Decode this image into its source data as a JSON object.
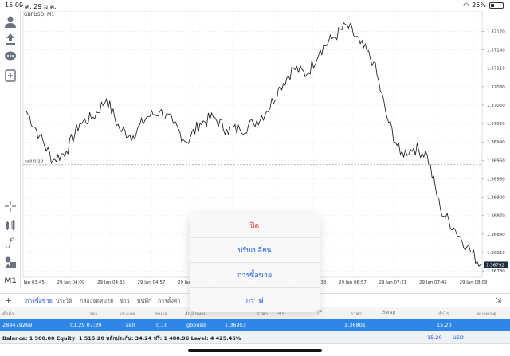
{
  "status": {
    "time": "15:09",
    "date": "ศ. 29 ม.ค.",
    "battery": "25%"
  },
  "chart": {
    "symbol_label": "GBPUSD, M1",
    "sell_label": "sell 0.10",
    "current_price_label": "1.36792",
    "price_ticks": [
      "1.37170",
      "1.37140",
      "1.37110",
      "1.37080",
      "1.37050",
      "1.37020",
      "1.36990",
      "1.36960",
      "1.36930",
      "1.36900",
      "1.36870",
      "1.36840",
      "1.36810",
      "1.36780"
    ],
    "time_ticks": [
      "29 Jan 03:45",
      "29 Jan 04:09",
      "29 Jan 04:33",
      "29 Jan 04:57",
      "29 Jan 05:21",
      "29 Jan 05:45",
      "29 Jan 06:09",
      "29 Jan 06:33",
      "29 Jan 06:57",
      "29 Jan 07:21",
      "29 Jan 07:45",
      "29 Jan 08:09"
    ]
  },
  "chart_data": {
    "type": "line",
    "title": "GBPUSD, M1",
    "xlabel": "",
    "ylabel": "",
    "ylim": [
      1.36775,
      1.3719
    ],
    "x": [
      "03:45",
      "03:52",
      "04:00",
      "04:09",
      "04:17",
      "04:25",
      "04:33",
      "04:41",
      "04:49",
      "04:57",
      "05:05",
      "05:13",
      "05:21",
      "05:29",
      "05:37",
      "05:45",
      "05:53",
      "06:01",
      "06:09",
      "06:17",
      "06:25",
      "06:33",
      "06:41",
      "06:49",
      "06:57",
      "07:05",
      "07:13",
      "07:21",
      "07:29",
      "07:37",
      "07:45",
      "07:53",
      "08:01",
      "08:05",
      "08:08"
    ],
    "y": [
      1.3704,
      1.37,
      1.3696,
      1.36975,
      1.3702,
      1.3703,
      1.3706,
      1.3701,
      1.37,
      1.3703,
      1.3704,
      1.3702,
      1.3699,
      1.3702,
      1.3703,
      1.3701,
      1.3701,
      1.3702,
      1.3704,
      1.3708,
      1.3711,
      1.371,
      1.3714,
      1.3716,
      1.3718,
      1.3715,
      1.3712,
      1.3703,
      1.3697,
      1.3698,
      1.3697,
      1.3688,
      1.3685,
      1.3682,
      1.3679
    ],
    "horizontal_line": {
      "label": "sell 0.10",
      "value": 1.36953
    }
  },
  "tabs": [
    "การซื้อขาย",
    "ประวัติ",
    "กล่องจดหมาย",
    "ข่าว",
    "บันทึก",
    "การตั้งค่า"
  ],
  "columns": [
    "คำสั่ง",
    "เวลา",
    "ประเภท",
    "ขนาด",
    "สัญลักษณ์",
    "ราคา",
    "S/L",
    "T/P",
    "ราคา",
    "Swap",
    "กำไร",
    "หมายเหตุ"
  ],
  "position": {
    "order": "288479269",
    "time": "01.29 07:39",
    "type": "sell",
    "size": "0.10",
    "symbol": "gbpusd",
    "open_price": "1.36953",
    "price": "1.36801",
    "profit": "15.20"
  },
  "balance": {
    "text": "Balance: 1 500.00 Equity: 1 515.20 หลักประกัน: 34.24 ฟรี: 1 480.96 Level: 4 425.46%",
    "total": "15.20",
    "currency": "USD"
  },
  "popup": {
    "close": "ปิด",
    "modify": "ปรับเปลี่ยน",
    "trade": "การซื้อขาย",
    "chart": "กราฟ"
  },
  "colors": {
    "accent": "#1a5fe0",
    "close_red": "#e23b2e",
    "row_blue": "#2e87e6"
  },
  "left_tools": [
    "account-icon",
    "trade-icon",
    "chat-icon",
    "new-order-icon",
    "crosshair-icon",
    "indicators-icon",
    "function-icon",
    "objects-icon",
    "timeframe-label"
  ],
  "timeframe": "M1"
}
